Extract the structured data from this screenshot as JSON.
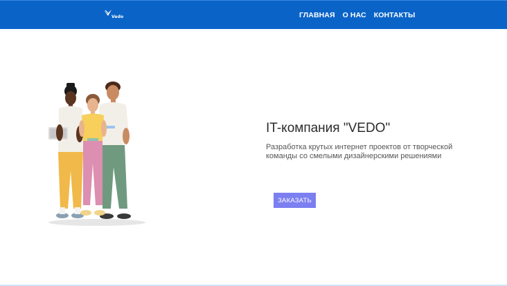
{
  "header": {
    "logo_text": "Vedo",
    "nav": [
      "ГЛАВНАЯ",
      "О НАС",
      "КОНТАКТЫ"
    ]
  },
  "hero": {
    "title": "IT-компания \"VEDO\"",
    "description": "Разработка крутых интернет проектов от творческой команды со смелыми дизайнерскими решениями",
    "button_label": "ЗАКАЗАТЬ",
    "illustration": "three-people-3d-illustration"
  },
  "colors": {
    "header_bg": "#0a64c8",
    "button_bg": "#7b7ff0",
    "title": "#2b2b2b",
    "text": "#555555"
  }
}
